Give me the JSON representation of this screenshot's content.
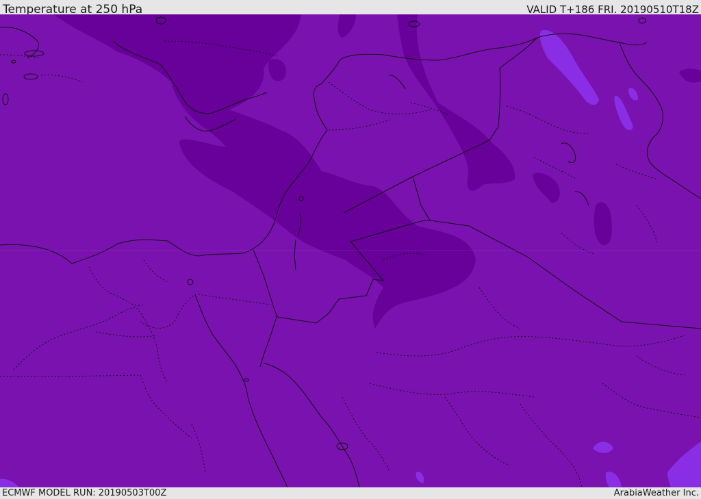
{
  "header": {
    "title": "Temperature at 250 hPa",
    "valid": "VALID T+186 FRI. 20190510T18Z"
  },
  "footer": {
    "model_run": "ECMWF MODEL RUN: 20190503T00Z",
    "credit": "ArabiaWeather Inc."
  },
  "map": {
    "colors": {
      "base_field": "#7a12b0",
      "darker_band": "#68009a",
      "lighter_pockets": "#8a2ee6",
      "borders": "#111111"
    }
  }
}
